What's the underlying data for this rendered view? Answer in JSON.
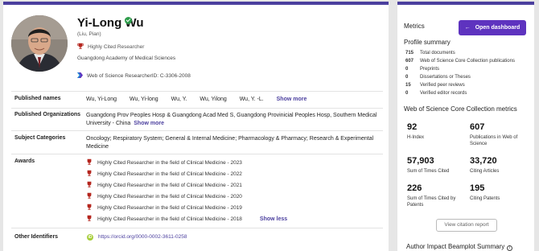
{
  "profile": {
    "name": "Yi-Long Wu",
    "alt_name": "(Liu, Pian)",
    "badge": "Highly Cited Researcher",
    "affiliation": "Guangdong Academy of Medical Sciences",
    "researcher_id": "Web of Science ResearcherID: C-3306-2008"
  },
  "published_names": {
    "label": "Published names",
    "items": [
      "Wu, Yi-Long",
      "Wu, Yi-long",
      "Wu, Y.",
      "Wu, Yilong",
      "Wu, Y. -L."
    ],
    "more": "Show more"
  },
  "published_orgs": {
    "label": "Published Organizations",
    "line1": "Guangdong Prov Peoples Hosp & Guangdong Acad Med S,  Guangdong Provinicial Peoples Hosp,  Southern Medical",
    "line2": "University - China",
    "more": "Show more"
  },
  "subject_categories": {
    "label": "Subject Categories",
    "line1": "Oncology;  Respiratory System;  General & Internal Medicine;  Pharmacology & Pharmacy;  Research & Experimental",
    "line2": "Medicine"
  },
  "awards": {
    "label": "Awards",
    "items": [
      "Highly Cited Researcher in the field of Clinical Medicine - 2023",
      "Highly Cited Researcher in the field of Clinical Medicine - 2022",
      "Highly Cited Researcher in the field of Clinical Medicine - 2021",
      "Highly Cited Researcher in the field of Clinical Medicine - 2020",
      "Highly Cited Researcher in the field of Clinical Medicine - 2019",
      "Highly Cited Researcher in the field of Clinical Medicine - 2018"
    ],
    "less": "Show less"
  },
  "other_identifiers": {
    "label": "Other Identifiers",
    "orcid": "https://orcid.org/0000-0002-3611-0258"
  },
  "sidebar": {
    "metrics_title": "Metrics",
    "dashboard_button": "Open dashboard",
    "profile_summary_title": "Profile summary",
    "summary": [
      {
        "value": "715",
        "label": "Total documents"
      },
      {
        "value": "607",
        "label": "Web of Science Core Collection publications"
      },
      {
        "value": "0",
        "label": "Preprints"
      },
      {
        "value": "0",
        "label": "Dissertations or Theses"
      },
      {
        "value": "15",
        "label": "Verified peer reviews"
      },
      {
        "value": "0",
        "label": "Verified editor records"
      }
    ],
    "wos_metrics_title": "Web of Science Core Collection metrics",
    "metrics": [
      {
        "value": "92",
        "label": "H-Index"
      },
      {
        "value": "607",
        "label": "Publications in Web of Science"
      },
      {
        "value": "57,903",
        "label": "Sum of Times Cited"
      },
      {
        "value": "33,720",
        "label": "Citing Articles"
      },
      {
        "value": "226",
        "label": "Sum of Times Cited by Patents"
      },
      {
        "value": "195",
        "label": "Citing Patents"
      }
    ],
    "citation_report_button": "View citation report",
    "beamplot_title": "Author Impact Beamplot Summary"
  },
  "colors": {
    "accent": "#4b3f9e",
    "button": "#5e33bf",
    "verified": "#2e9d4b",
    "award": "#b5261e",
    "orcid": "#a6ce39"
  },
  "icons": [
    "verified-check-icon",
    "trophy-icon",
    "wos-logo-icon",
    "orcid-icon",
    "arrow-left-icon",
    "info-icon"
  ]
}
